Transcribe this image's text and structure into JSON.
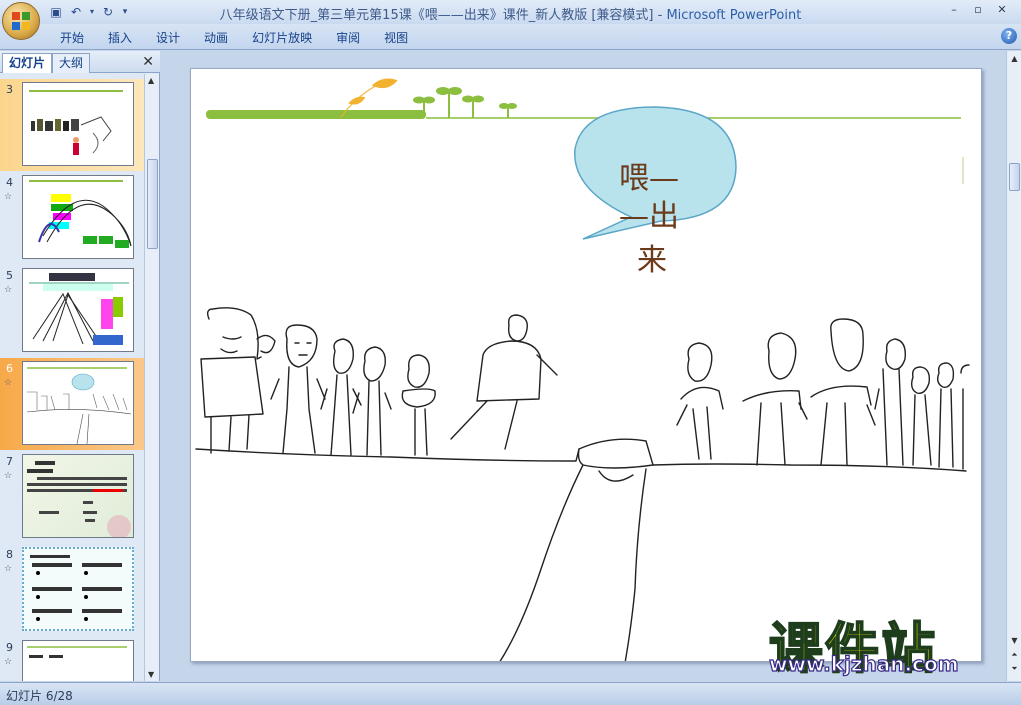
{
  "window": {
    "title_doc": "八年级语文下册_第三单元第15课《喂——出来》课件_新人教版 [兼容模式] - ",
    "title_app": "Microsoft PowerPoint",
    "minimize": "–",
    "maximize": "▫",
    "close": "✕"
  },
  "ribbon": {
    "tabs": [
      "开始",
      "插入",
      "设计",
      "动画",
      "幻灯片放映",
      "审阅",
      "视图"
    ],
    "help": "?"
  },
  "pane": {
    "tab_slides": "幻灯片",
    "tab_outline": "大纲",
    "close": "✕"
  },
  "slides": [
    {
      "num": "3",
      "star": ""
    },
    {
      "num": "4",
      "star": "☆"
    },
    {
      "num": "5",
      "star": "☆"
    },
    {
      "num": "6",
      "star": "☆"
    },
    {
      "num": "7",
      "star": "☆"
    },
    {
      "num": "8",
      "star": "☆"
    },
    {
      "num": "9",
      "star": "☆"
    }
  ],
  "current_slide": {
    "bubble_line1": "喂—",
    "bubble_line2": "—出",
    "bubble_line3": "来"
  },
  "watermark": {
    "cn": "课件站",
    "url": "www.kjzhan.com"
  },
  "status": {
    "slide_info": "幻灯片 6/28"
  },
  "colors": {
    "selected_slide": "#f7a948",
    "bubble_fill": "#b9e3ec",
    "deco_green": "#8cbf3f"
  }
}
